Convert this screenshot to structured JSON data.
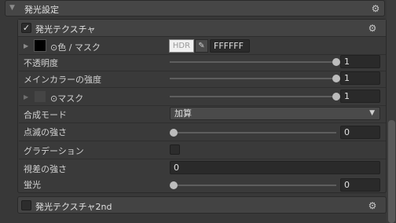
{
  "section": {
    "title": "発光設定",
    "icon": "gear-icon"
  },
  "subpanel": {
    "title": "発光テクスチャ",
    "enabled": true,
    "rows": {
      "color_mask_label": "⊙色 / マスク",
      "hdr_label": "HDR",
      "hex_value": "FFFFFF",
      "opacity_label": "不透明度",
      "opacity_value": "1",
      "main_color_strength_label": "メインカラーの強度",
      "main_color_strength_value": "1",
      "mask_label": "⊙マスク",
      "mask_value": "1",
      "blend_mode_label": "合成モード",
      "blend_mode_value": "加算",
      "blink_strength_label": "点滅の強さ",
      "blink_strength_value": "0",
      "gradation_label": "グラデーション",
      "parallax_strength_label": "視差の強さ",
      "parallax_strength_value": "0",
      "fluorescence_label": "蛍光",
      "fluorescence_value": "0"
    }
  },
  "second_panel": {
    "title": "発光テクスチャ2nd",
    "enabled": false
  },
  "levels": {
    "opacity": 1,
    "main_color_strength": 1,
    "mask": 1,
    "blink_strength": 0,
    "fluorescence": 0
  },
  "colors": {
    "background": "#383838",
    "emission_color": "#FFFFFF"
  }
}
